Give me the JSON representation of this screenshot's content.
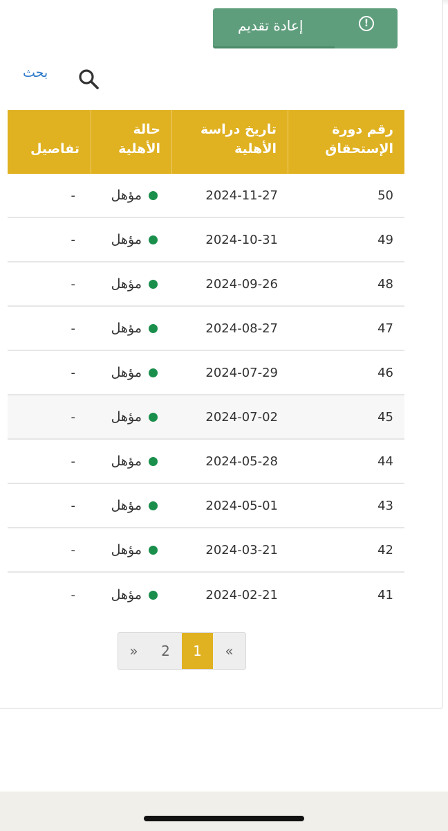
{
  "toolbar": {
    "reapply_label": "إعادة تقديم",
    "alert_icon": "!",
    "search_label": "بحث"
  },
  "table": {
    "headers": {
      "cycle_line1": "رقم دورة",
      "cycle_line2": "الإستحقاق",
      "date_line1": "تاريخ دراسة",
      "date_line2": "الأهلية",
      "status_line1": "حالة",
      "status_line2": "الأهلية",
      "details": "تفاصيل"
    },
    "rows": [
      {
        "cycle": "50",
        "date": "2024-11-27",
        "status": "مؤهل",
        "details": "-"
      },
      {
        "cycle": "49",
        "date": "2024-10-31",
        "status": "مؤهل",
        "details": "-"
      },
      {
        "cycle": "48",
        "date": "2024-09-26",
        "status": "مؤهل",
        "details": "-"
      },
      {
        "cycle": "47",
        "date": "2024-08-27",
        "status": "مؤهل",
        "details": "-"
      },
      {
        "cycle": "46",
        "date": "2024-07-29",
        "status": "مؤهل",
        "details": "-"
      },
      {
        "cycle": "45",
        "date": "2024-07-02",
        "status": "مؤهل",
        "details": "-"
      },
      {
        "cycle": "44",
        "date": "2024-05-28",
        "status": "مؤهل",
        "details": "-"
      },
      {
        "cycle": "43",
        "date": "2024-05-01",
        "status": "مؤهل",
        "details": "-"
      },
      {
        "cycle": "42",
        "date": "2024-03-21",
        "status": "مؤهل",
        "details": "-"
      },
      {
        "cycle": "41",
        "date": "2024-02-21",
        "status": "مؤهل",
        "details": "-"
      }
    ]
  },
  "pagination": {
    "next": "»",
    "page2": "2",
    "page1": "1",
    "prev": "«",
    "current_page": "1"
  },
  "colors": {
    "accent": "#e0b121",
    "button": "#5f9e7d",
    "status_dot": "#1a8f4b",
    "link": "#2a78c8"
  },
  "icons": {
    "search": "search-icon",
    "alert": "alert-circle-icon"
  }
}
